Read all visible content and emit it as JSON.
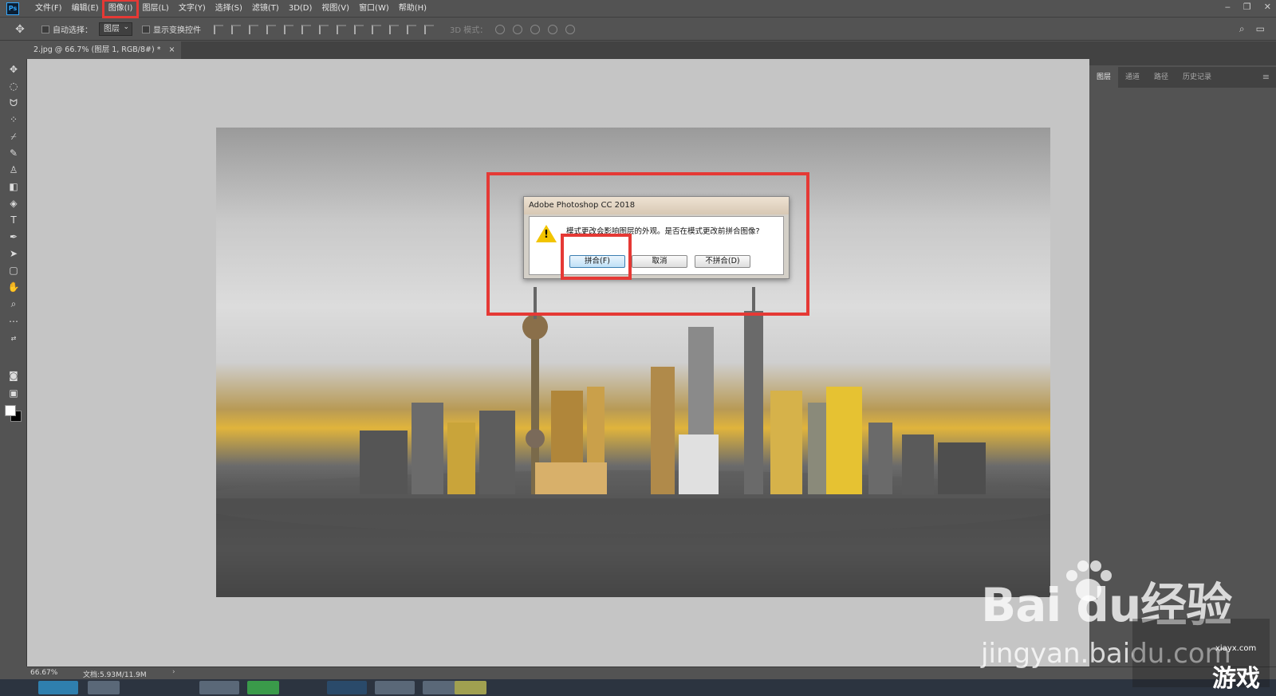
{
  "menubar": {
    "logo": "Ps",
    "items": [
      "文件(F)",
      "编辑(E)",
      "图像(I)",
      "图层(L)",
      "文字(Y)",
      "选择(S)",
      "滤镜(T)",
      "3D(D)",
      "视图(V)",
      "窗口(W)",
      "帮助(H)"
    ],
    "highlighted": "图像(I)"
  },
  "options": {
    "auto_select_label": "自动选择：",
    "auto_select_value": "图层",
    "show_transform_label": "显示变换控件",
    "mode_3d_label": "3D 模式："
  },
  "document_tab": {
    "label": "2.jpg @ 66.7% (图层 1, RGB/8#) *",
    "close": "×"
  },
  "panel": {
    "tabs": [
      "图层",
      "通道",
      "路径",
      "历史记录"
    ],
    "active_tab": "图层",
    "menu_icon": "hamburger-icon"
  },
  "dialog": {
    "title": "Adobe Photoshop CC 2018",
    "message": "模式更改会影响图层的外观。是否在模式更改前拼合图像?",
    "icon": "warning-icon",
    "buttons": {
      "flatten": "拼合(F)",
      "cancel": "取消",
      "dont_flatten": "不拼合(D)"
    }
  },
  "status": {
    "zoom": "66.67%",
    "doc_size": "文档:5.93M/11.9M",
    "arrow": "›"
  },
  "watermarks": {
    "baidu": "Bai  du经验",
    "url": "jingyan.baidu.com",
    "corner_text": "游戏",
    "corner_site": "xiayx.com"
  },
  "colors": {
    "highlight_red": "#e53935",
    "ps_blue": "#31a8ff",
    "ui_gray": "#535353"
  }
}
